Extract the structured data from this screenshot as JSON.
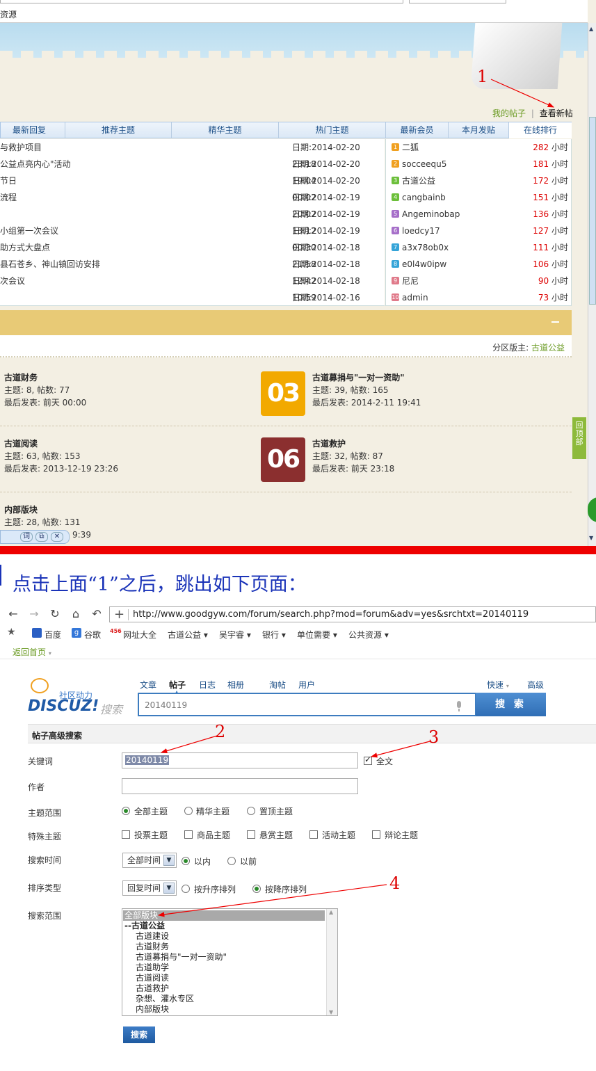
{
  "top_browser": {
    "source_menu": "资源"
  },
  "annotations": {
    "n1": "1",
    "n2": "2",
    "n3": "3",
    "n4": "4"
  },
  "links": {
    "my_posts": "我的帖子",
    "sep": "|",
    "new_posts": "查看新帖"
  },
  "tabs": [
    "最新回复",
    "推荐主题",
    "精华主题",
    "热门主题",
    "最新会员",
    "本月发贴",
    "在线排行"
  ],
  "threads": [
    {
      "title": "与救护项目",
      "date": "日期:2014-02-20 23:18"
    },
    {
      "title": "公益点亮内心\"活动",
      "date": "日期:2014-02-20 19:04"
    },
    {
      "title": "节日",
      "date": "日期:2014-02-20 00:02"
    },
    {
      "title": "流程",
      "date": "日期:2014-02-19 20:02"
    },
    {
      "title": "",
      "date": "日期:2014-02-19 13:12"
    },
    {
      "title": "小组第一次会议",
      "date": "日期:2014-02-19 00:30"
    },
    {
      "title": "助方式大盘点",
      "date": "日期:2014-02-18 21:58"
    },
    {
      "title": "县石苍乡、神山镇回访安排",
      "date": "日期:2014-02-18 12:42"
    },
    {
      "title": "次会议",
      "date": "日期:2014-02-18 10:59"
    },
    {
      "title": "",
      "date": "日期:2014-02-16 23:34"
    }
  ],
  "members": [
    {
      "rank": "1",
      "name": "二狐",
      "hours": "282",
      "color": "#f0a020"
    },
    {
      "rank": "2",
      "name": "socceequ5",
      "hours": "181",
      "color": "#f0a020"
    },
    {
      "rank": "3",
      "name": "古道公益",
      "hours": "172",
      "color": "#6cbf3a"
    },
    {
      "rank": "4",
      "name": "cangbainb",
      "hours": "151",
      "color": "#6cbf3a"
    },
    {
      "rank": "5",
      "name": "Angeminobap",
      "hours": "136",
      "color": "#a66fc9"
    },
    {
      "rank": "6",
      "name": "loedcy17",
      "hours": "127",
      "color": "#a66fc9"
    },
    {
      "rank": "7",
      "name": "a3x78ob0x",
      "hours": "111",
      "color": "#35a4d8"
    },
    {
      "rank": "8",
      "name": "e0l4w0ipw",
      "hours": "106",
      "color": "#35a4d8"
    },
    {
      "rank": "9",
      "name": "尼尼",
      "hours": "90",
      "color": "#e07a8a"
    },
    {
      "rank": "10",
      "name": "admin",
      "hours": "73",
      "color": "#e07a8a"
    }
  ],
  "hour_unit": "小时",
  "moderator": {
    "label": "分区版主:",
    "name": "古道公益"
  },
  "forums": [
    {
      "name": "古道财务",
      "stats": "主题: 8, 帖数: 77",
      "last": "最后发表: 前天 00:00"
    },
    {
      "name": "古道募捐与\"一对一资助\"",
      "stats": "主题: 39, 帖数: 165",
      "last": "最后发表: 2014-2-11 19:41",
      "icon": "03",
      "icon_color": "#f2a900"
    },
    {
      "name": "古道阅读",
      "stats": "主题: 63, 帖数: 153",
      "last": "最后发表: 2013-12-19 23:26"
    },
    {
      "name": "古道救护",
      "stats": "主题: 32, 帖数: 87",
      "last": "最后发表: 前天 23:18",
      "icon": "06",
      "icon_color": "#8b2f2f"
    },
    {
      "name": "内部版块",
      "stats": "主题: 28, 帖数: 131",
      "last": "9:39"
    }
  ],
  "backtop": "回顶部",
  "dict": [
    "词",
    "⧉",
    "✕"
  ],
  "caption": "点击上面“1”之后，跳出如下页面：",
  "url": "http://www.goodgyw.com/forum/search.php?mod=forum&adv=yes&srchtxt=20140119",
  "bookmarks": [
    "百度",
    "谷歌",
    "网址大全",
    "古道公益 ▾",
    "吴宇睿 ▾",
    "银行 ▾",
    "单位需要 ▾",
    "公共资源 ▾"
  ],
  "back_home": "返回首页",
  "logo": {
    "slogan": "社区动力",
    "brand": "DISCUZ!",
    "sub": "搜索"
  },
  "search_nav": [
    "文章",
    "帖子",
    "日志",
    "相册",
    "淘帖",
    "用户"
  ],
  "search_nav_right": [
    "快速",
    "高级"
  ],
  "search_value": "20140119",
  "search_button": "搜 索",
  "adv_title": "帖子高级搜索",
  "form": {
    "keyword_label": "关键词",
    "keyword_value": "20140119",
    "fulltext": "全文",
    "author_label": "作者",
    "scope_label": "主题范围",
    "scope_opts": [
      "全部主题",
      "精华主题",
      "置顶主题"
    ],
    "special_label": "特殊主题",
    "special_opts": [
      "投票主题",
      "商品主题",
      "悬赏主题",
      "活动主题",
      "辩论主题"
    ],
    "time_label": "搜索时间",
    "time_select": "全部时间",
    "time_opts": [
      "以内",
      "以前"
    ],
    "sort_label": "排序类型",
    "sort_select": "回复时间",
    "sort_opts": [
      "按升序排列",
      "按降序排列"
    ],
    "range_label": "搜索范围",
    "range_items": [
      "全部版块",
      "--古道公益",
      "古道建设",
      "古道财务",
      "古道募捐与\"一对一资助\"",
      "古道助学",
      "古道阅读",
      "古道救护",
      "杂想、灌水专区",
      "内部版块"
    ],
    "submit": "搜索"
  }
}
